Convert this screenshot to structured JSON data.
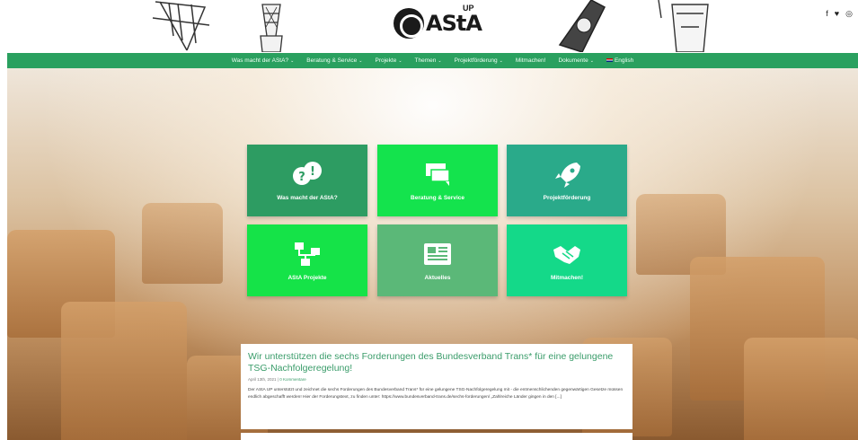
{
  "header": {
    "logo_text": "AStA",
    "logo_sup": "UP",
    "social": [
      "f",
      "♥",
      "◎"
    ]
  },
  "nav": {
    "items": [
      {
        "label": "Was macht der AStA?",
        "dropdown": true
      },
      {
        "label": "Beratung & Service",
        "dropdown": true
      },
      {
        "label": "Projekte",
        "dropdown": true
      },
      {
        "label": "Themen",
        "dropdown": true
      },
      {
        "label": "Projektförderung",
        "dropdown": true
      },
      {
        "label": "Mitmachen!",
        "dropdown": false
      },
      {
        "label": "Dokumente",
        "dropdown": true
      },
      {
        "label": "English",
        "dropdown": false
      }
    ]
  },
  "tiles": [
    {
      "label": "Was macht der AStA?",
      "icon": "question-exclamation-icon",
      "color": "#2d9c62"
    },
    {
      "label": "Beratung & Service",
      "icon": "chat-icon",
      "color": "#14e34d"
    },
    {
      "label": "Projektförderung",
      "icon": "rocket-icon",
      "color": "#2aaa8a"
    },
    {
      "label": "AStA Projekte",
      "icon": "sitemap-icon",
      "color": "#15e348"
    },
    {
      "label": "Aktuelles",
      "icon": "newspaper-icon",
      "color": "#5bb878"
    },
    {
      "label": "Mitmachen!",
      "icon": "handshake-icon",
      "color": "#14d989"
    }
  ],
  "post": {
    "title": "Wir unterstützen die sechs Forderungen des Bundesverband Trans* für eine gelungene TSG-Nachfolgeregelung!",
    "date": "April 13th, 2021",
    "separator": " | ",
    "comments": "0 Kommentare",
    "body": "Der AStA UP unterstützt und zeichnet die sechs Forderungen des Bundesverband Trans* für eine gelungene TSG-Nachfolgeregelung mit - die entmenschlichenden gegenwärtigen Gesetze müssen endlich abgeschafft werden! Hier der Forderungstext, zu finden unter: https://www.bundesverband-trans.de/sechs-forderungen/ „Zahlreiche Länder gingen in den [...]"
  }
}
